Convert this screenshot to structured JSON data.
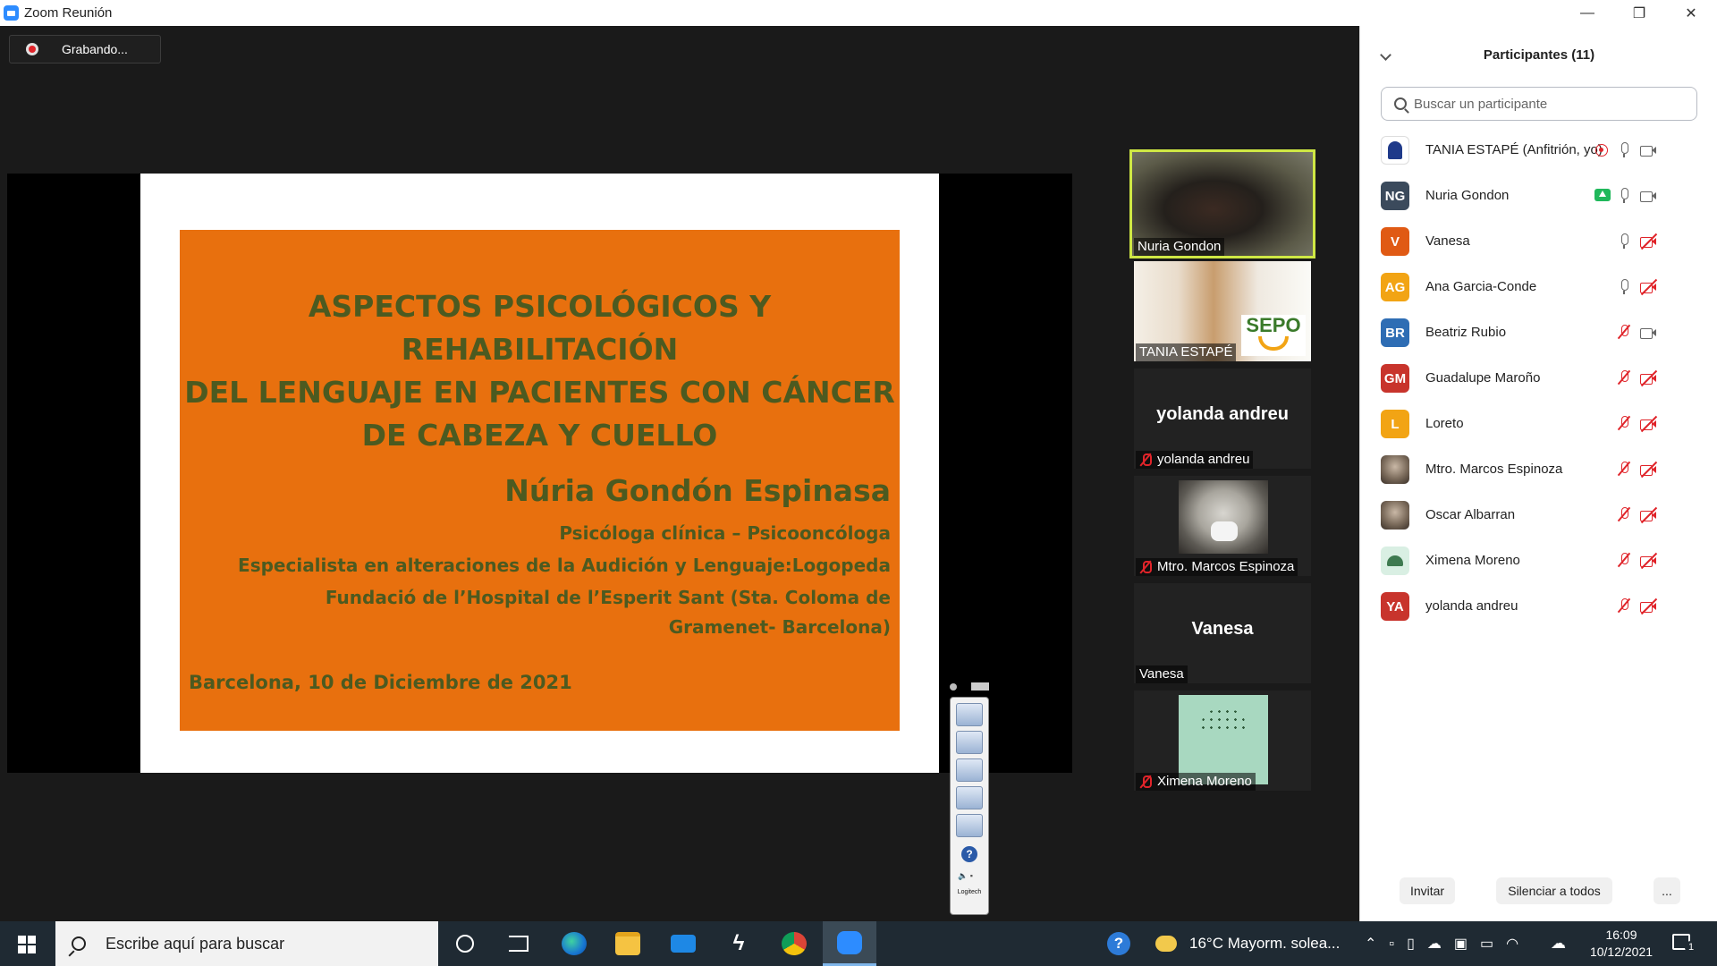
{
  "window": {
    "title": "Zoom Reunión",
    "controls": {
      "minimize": "—",
      "restore": "❐",
      "close": "✕"
    }
  },
  "recording": {
    "label": "Grabando..."
  },
  "slide": {
    "title_lines": [
      "ASPECTOS PSICOLÓGICOS Y REHABILITACIÓN",
      "DEL LENGUAJE EN PACIENTES CON CÁNCER",
      "DE CABEZA Y CUELLO"
    ],
    "author": "Núria Gondón Espinasa",
    "role": "Psicóloga clínica – Psicooncóloga",
    "specialty": "Especialista en alteraciones de la Audición y Lenguaje:Logopeda",
    "institution": "Fundació de l’Hospital de l’Esperit Sant (Sta. Coloma de Gramenet- Barcelona)",
    "date": "Barcelona, 10 de Diciembre de 2021",
    "colors": {
      "box": "#e8700e",
      "text": "#4c5a20"
    }
  },
  "logitech": {
    "help": "?",
    "brand": "Logitech"
  },
  "videos": [
    {
      "name": "Nuria Gondon",
      "big": "",
      "muted": false
    },
    {
      "name": "TANIA ESTAPÉ",
      "big": "",
      "muted": false,
      "logo": "SEPO"
    },
    {
      "name": "yolanda andreu",
      "big": "yolanda andreu",
      "muted": true
    },
    {
      "name": "Mtro. Marcos Espinoza",
      "big": "",
      "muted": true
    },
    {
      "name": "Vanesa",
      "big": "Vanesa",
      "muted": false
    },
    {
      "name": "Ximena Moreno",
      "big": "",
      "muted": true
    }
  ],
  "participants": {
    "title": "Participantes (11)",
    "search_placeholder": "Buscar un participante",
    "list": [
      {
        "initials": "",
        "name": "TANIA ESTAPÉ (Anfitrión, yo)",
        "color": "#ffffff",
        "type": "logo",
        "mic": "on",
        "cam": "on",
        "extra": "rec"
      },
      {
        "initials": "NG",
        "name": "Nuria Gondon",
        "color": "#3b4a5c",
        "type": "initials",
        "mic": "on",
        "cam": "on",
        "extra": "share"
      },
      {
        "initials": "V",
        "name": "Vanesa",
        "color": "#e05a14",
        "type": "initials",
        "mic": "on",
        "cam": "off",
        "extra": ""
      },
      {
        "initials": "AG",
        "name": "Ana Garcia-Conde",
        "color": "#f2a414",
        "type": "initials",
        "mic": "on",
        "cam": "off",
        "extra": ""
      },
      {
        "initials": "BR",
        "name": "Beatriz Rubio",
        "color": "#2e6db4",
        "type": "initials",
        "mic": "off",
        "cam": "on",
        "extra": ""
      },
      {
        "initials": "GM",
        "name": "Guadalupe Maroño",
        "color": "#c8342c",
        "type": "initials",
        "mic": "off",
        "cam": "off",
        "extra": ""
      },
      {
        "initials": "L",
        "name": "Loreto",
        "color": "#f2a414",
        "type": "initials",
        "mic": "off",
        "cam": "off",
        "extra": ""
      },
      {
        "initials": "",
        "name": "Mtro. Marcos Espinoza",
        "color": "#8a7a6a",
        "type": "photo",
        "mic": "off",
        "cam": "off",
        "extra": ""
      },
      {
        "initials": "",
        "name": "Oscar Albarran",
        "color": "#5a4a3a",
        "type": "photo",
        "mic": "off",
        "cam": "off",
        "extra": ""
      },
      {
        "initials": "",
        "name": "Ximena Moreno",
        "color": "#d9efe3",
        "type": "tree",
        "mic": "off",
        "cam": "off",
        "extra": ""
      },
      {
        "initials": "YA",
        "name": "yolanda andreu",
        "color": "#c8342c",
        "type": "initials",
        "mic": "off",
        "cam": "off",
        "extra": ""
      }
    ],
    "invite_label": "Invitar",
    "mute_all_label": "Silenciar a todos",
    "more_label": "..."
  },
  "taskbar": {
    "search_placeholder": "Escribe aquí para buscar",
    "weather": "16°C  Mayorm. solea...",
    "time": "16:09",
    "date": "10/12/2021",
    "notif_count": "1"
  }
}
